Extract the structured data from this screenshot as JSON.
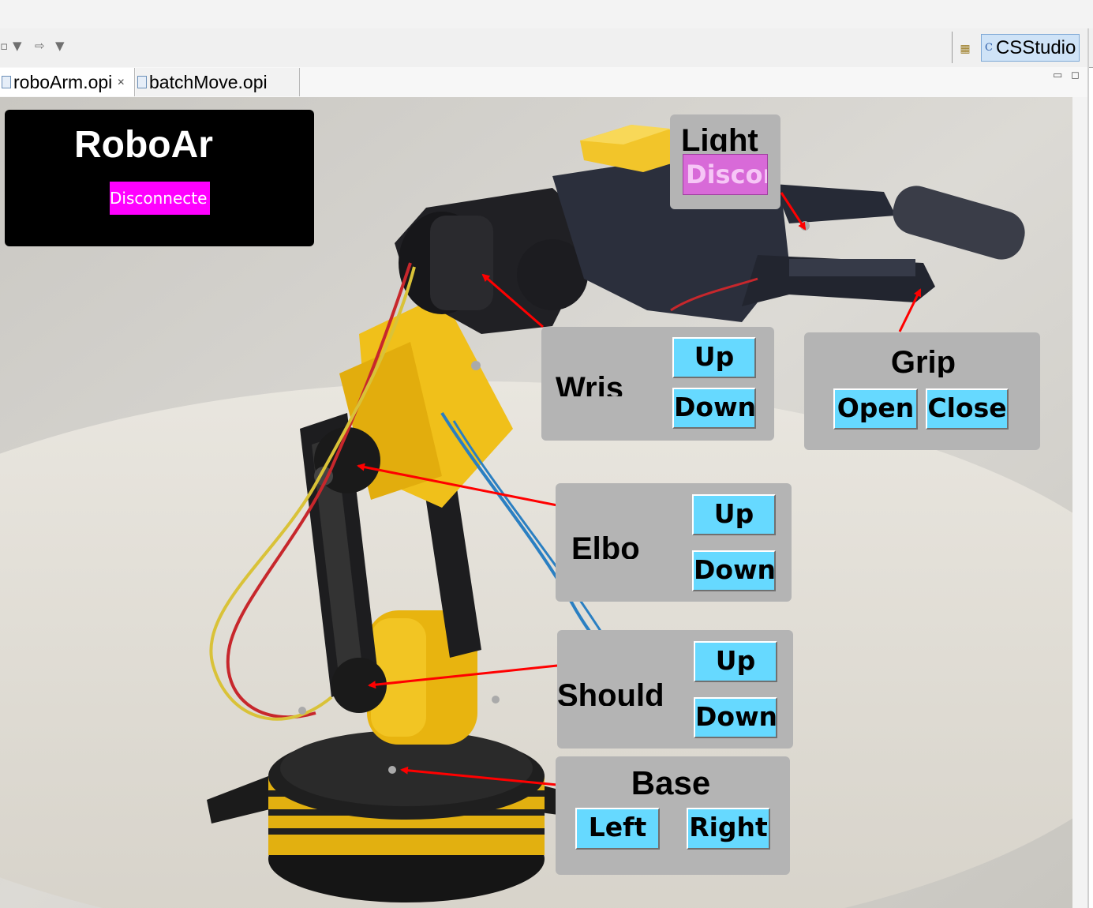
{
  "perspective": {
    "label": "CSStudio",
    "icon": "csstudio-perspective-icon"
  },
  "tabs": [
    {
      "label": "roboArm.opi",
      "icon": "opi-file-icon",
      "active": true
    },
    {
      "label": "batchMove.opi",
      "icon": "opi-file-icon",
      "active": false
    }
  ],
  "main": {
    "title": "RoboAr",
    "status": "Disconnecte",
    "status_color": "#ff00ff"
  },
  "light": {
    "title": "Light",
    "status": "Discor",
    "status_color": "#d86ad8"
  },
  "wrist": {
    "title": "Wris",
    "up_label": "Up",
    "down_label": "Down"
  },
  "grip": {
    "title": "Grip",
    "open_label": "Open",
    "close_label": "Close"
  },
  "elbow": {
    "title": "Elbo",
    "up_label": "Up",
    "down_label": "Down"
  },
  "shoulder": {
    "title": "Should",
    "up_label": "Up",
    "down_label": "Down"
  },
  "base": {
    "title": "Base",
    "left_label": "Left",
    "right_label": "Right"
  },
  "colors": {
    "button": "#66d9ff",
    "panel": "#b4b4b4",
    "arrow": "#ff0000"
  }
}
